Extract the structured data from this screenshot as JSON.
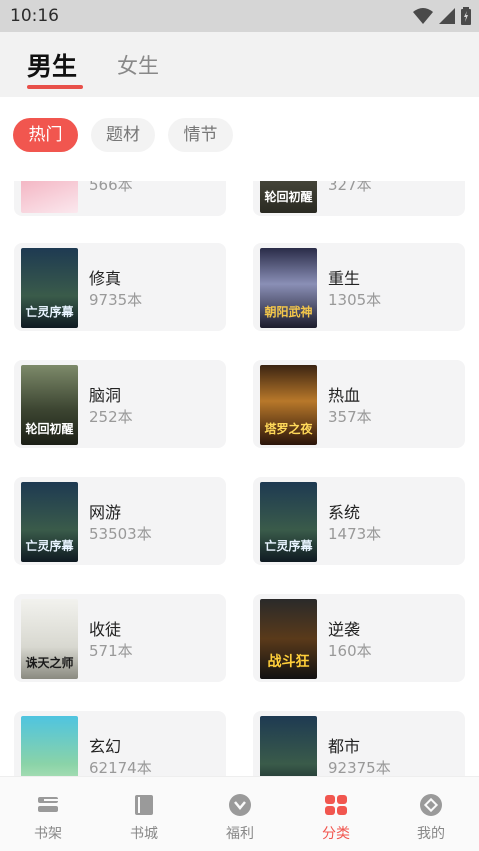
{
  "status_bar": {
    "time": "10:16"
  },
  "header": {
    "tabs": [
      {
        "label": "男生",
        "active": true
      },
      {
        "label": "女生",
        "active": false
      }
    ],
    "accent_color": "#e8504a"
  },
  "filters": [
    {
      "label": "热门",
      "active": true
    },
    {
      "label": "题材",
      "active": false
    },
    {
      "label": "情节",
      "active": false
    }
  ],
  "categories": [
    {
      "name": "",
      "count": "566本",
      "cover_text": "",
      "partial": true
    },
    {
      "name": "",
      "count": "327本",
      "cover_text": "轮回初醒",
      "partial": true
    },
    {
      "name": "修真",
      "count": "9735本",
      "cover_text": "亡灵序幕"
    },
    {
      "name": "重生",
      "count": "1305本",
      "cover_text": "朝阳武神"
    },
    {
      "name": "脑洞",
      "count": "252本",
      "cover_text": "轮回初醒"
    },
    {
      "name": "热血",
      "count": "357本",
      "cover_text": "塔罗之夜"
    },
    {
      "name": "网游",
      "count": "53503本",
      "cover_text": "亡灵序幕"
    },
    {
      "name": "系统",
      "count": "1473本",
      "cover_text": "亡灵序幕"
    },
    {
      "name": "收徒",
      "count": "571本",
      "cover_text": "诛天之师"
    },
    {
      "name": "逆袭",
      "count": "160本",
      "cover_text": "战斗狂"
    },
    {
      "name": "玄幻",
      "count": "62174本",
      "cover_text": ""
    },
    {
      "name": "都市",
      "count": "92375本",
      "cover_text": ""
    }
  ],
  "bottom_nav": [
    {
      "label": "书架",
      "icon": "bookshelf-icon",
      "active": false
    },
    {
      "label": "书城",
      "icon": "book-icon",
      "active": false
    },
    {
      "label": "福利",
      "icon": "gift-icon",
      "active": false
    },
    {
      "label": "分类",
      "icon": "category-icon",
      "active": true
    },
    {
      "label": "我的",
      "icon": "profile-icon",
      "active": false
    }
  ]
}
